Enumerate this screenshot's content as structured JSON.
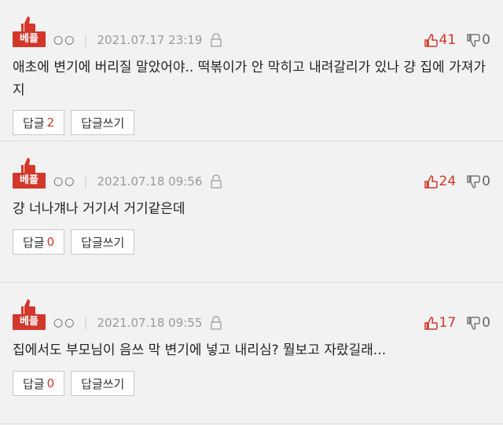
{
  "colors": {
    "accent": "#d2372a",
    "background": "#f2f2f2"
  },
  "comments": [
    {
      "badge": "베플",
      "user": "○○",
      "date": "2021.07.17 23:19",
      "up": "41",
      "down": "0",
      "text": "애초에 변기에 버리질 말았어야.. 떡볶이가 안 막히고 내려갈리가 있나 걍 집에 가져가지",
      "reply_label": "답글",
      "reply_count": "2",
      "write_label": "답글쓰기"
    },
    {
      "badge": "베플",
      "user": "○○",
      "date": "2021.07.18 09:56",
      "up": "24",
      "down": "0",
      "text": "걍 너나걔나 거기서 거기같은데",
      "reply_label": "답글",
      "reply_count": "0",
      "write_label": "답글쓰기"
    },
    {
      "badge": "베플",
      "user": "○○",
      "date": "2021.07.18 09:55",
      "up": "17",
      "down": "0",
      "text": "집에서도 부모님이 음쓰 막 변기에 넣고 내리심? 뭘보고 자랐길래...",
      "reply_label": "답글",
      "reply_count": "0",
      "write_label": "답글쓰기"
    }
  ]
}
